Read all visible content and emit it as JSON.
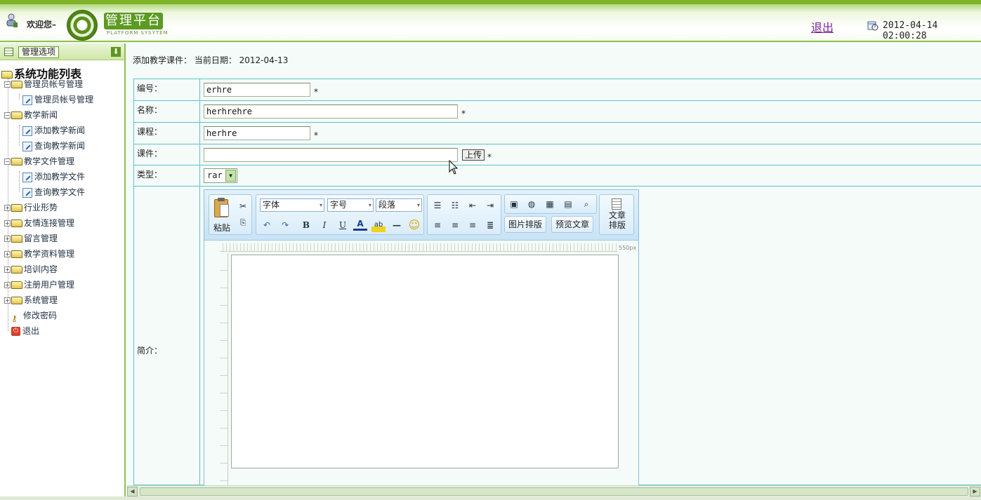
{
  "header": {
    "welcome": "欢迎您–",
    "logo_title": "管理平台",
    "logo_subtitle": "PLATFORM SYSYTEM",
    "logout": "退出",
    "datetime": "2012-04-14 02:00:28"
  },
  "sidebar": {
    "head_button": "管理选项",
    "root": "系统功能列表",
    "items": [
      {
        "label": "管理员帐号管理",
        "type": "folder",
        "expanded": true
      },
      {
        "label": "管理员帐号管理",
        "type": "page"
      },
      {
        "label": "教学新闻",
        "type": "folder",
        "expanded": true
      },
      {
        "label": "添加教学新闻",
        "type": "page"
      },
      {
        "label": "查询教学新闻",
        "type": "page"
      },
      {
        "label": "教学文件管理",
        "type": "folder",
        "expanded": true
      },
      {
        "label": "添加教学文件",
        "type": "page"
      },
      {
        "label": "查询教学文件",
        "type": "page"
      },
      {
        "label": "行业形势",
        "type": "folder",
        "expanded": false
      },
      {
        "label": "友情连接管理",
        "type": "folder",
        "expanded": false
      },
      {
        "label": "留言管理",
        "type": "folder",
        "expanded": false
      },
      {
        "label": "教学资料管理",
        "type": "folder",
        "expanded": false
      },
      {
        "label": "培训内容",
        "type": "folder",
        "expanded": false
      },
      {
        "label": "注册用户管理",
        "type": "folder",
        "expanded": false
      },
      {
        "label": "系统管理",
        "type": "folder",
        "expanded": false
      },
      {
        "label": "修改密码",
        "type": "key"
      },
      {
        "label": "退出",
        "type": "exit"
      }
    ]
  },
  "main": {
    "breadcrumb": "添加教学课件： 当前日期： 2012-04-13",
    "fields": {
      "id_label": "编号：",
      "id_value": "erhre",
      "name_label": "名称：",
      "name_value": "herhrehre",
      "course_label": "课程：",
      "course_value": "herhre",
      "file_label": "课件：",
      "file_value": "",
      "upload_button": "上传",
      "type_label": "类型：",
      "type_value": "rar",
      "intro_label": "简介：",
      "required_mark": "*"
    },
    "editor": {
      "paste": "粘贴",
      "font": "字体",
      "size": "字号",
      "paragraph": "段落",
      "image_layout": "图片排版",
      "preview": "预览文章",
      "article_layout": "文章排版",
      "ruler_label": "550px"
    }
  }
}
